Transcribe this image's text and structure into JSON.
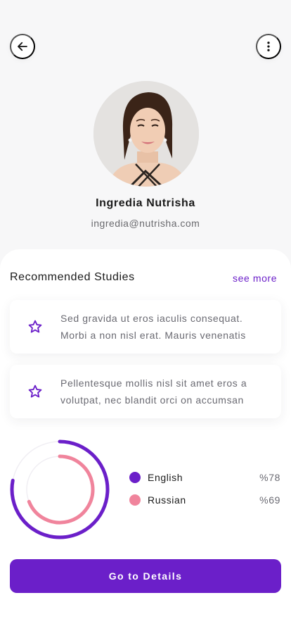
{
  "header": {
    "back_icon": "arrow-left-icon",
    "more_icon": "more-vertical-icon"
  },
  "profile": {
    "name": "Ingredia Nutrisha",
    "email": "ingredia@nutrisha.com"
  },
  "recommended": {
    "title": "Recommended Studies",
    "see_more": "see more",
    "items": [
      {
        "icon": "star-outline-icon",
        "line1": "Sed gravida ut eros iaculis consequat.",
        "line2": "Morbi a non nisl erat. Mauris venenatis"
      },
      {
        "icon": "star-outline-icon",
        "line1": "Pellentesque mollis nisl sit amet eros a",
        "line2": "volutpat, nec blandit orci on accumsan"
      }
    ]
  },
  "chart_data": {
    "type": "radial-progress",
    "series": [
      {
        "name": "English",
        "value": 78,
        "label": "%78",
        "color": "#6b1fc9"
      },
      {
        "name": "Russian",
        "value": 69,
        "label": "%69",
        "color": "#f0849c"
      }
    ],
    "max": 100
  },
  "footer": {
    "cta_label": "Go to Details"
  },
  "colors": {
    "accent": "#6b1fc9",
    "secondary": "#f0849c",
    "background": "#f7f7f8"
  }
}
